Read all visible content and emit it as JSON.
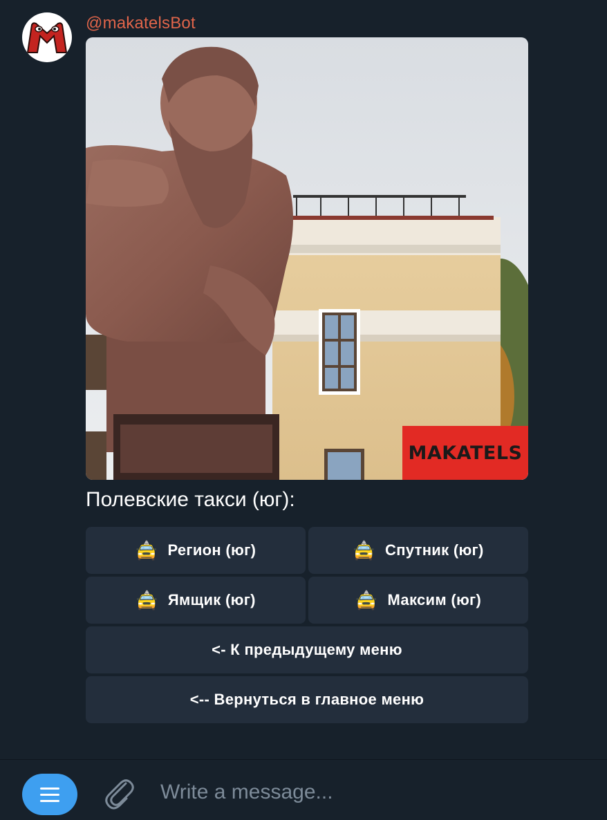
{
  "message": {
    "sender": "@makatelsBot",
    "photo": {
      "subject": "Monument with building",
      "watermark": "MAKATELS"
    },
    "caption": "Полевские такси (юг):"
  },
  "keyboard": {
    "taxi_icon": "🚖",
    "buttons": [
      {
        "label": "Регион (юг)",
        "icon": "taxi-icon"
      },
      {
        "label": "Спутник (юг)",
        "icon": "taxi-icon"
      },
      {
        "label": "Ямщик (юг)",
        "icon": "taxi-icon"
      },
      {
        "label": "Максим (юг)",
        "icon": "taxi-icon"
      },
      {
        "label": "<- К предыдущему меню"
      },
      {
        "label": "<-- Вернуться в главное меню"
      }
    ]
  },
  "composer": {
    "placeholder": "Write a message..."
  },
  "colors": {
    "background": "#17212b",
    "button": "#232e3c",
    "accent": "#3e9ff0",
    "sender_name": "#e0654a",
    "watermark_bg": "#e22a24"
  }
}
